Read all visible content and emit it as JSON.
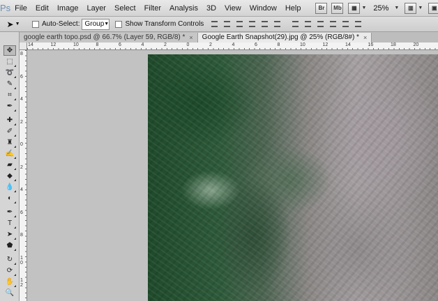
{
  "app": {
    "logo": "Ps"
  },
  "menu": [
    "File",
    "Edit",
    "Image",
    "Layer",
    "Select",
    "Filter",
    "Analysis",
    "3D",
    "View",
    "Window",
    "Help"
  ],
  "menubar_buttons": {
    "bridge": "Br",
    "minibridge": "Mb",
    "zoom": "25%"
  },
  "options": {
    "auto_select_label": "Auto-Select:",
    "auto_select_value": "Group",
    "show_transform_label": "Show Transform Controls"
  },
  "tabs": [
    {
      "label": "google earth topo.psd @ 66.7% (Layer 59, RGB/8) *",
      "close": "×"
    },
    {
      "label": "Google Earth Snapshot(29).jpg @ 25% (RGB/8#) *",
      "close": "×"
    }
  ],
  "ruler": {
    "h_labels": [
      "14",
      "12",
      "10",
      "8",
      "6",
      "4",
      "2",
      "0",
      "2",
      "4",
      "6",
      "8",
      "10",
      "12",
      "14",
      "16",
      "18",
      "20"
    ],
    "v_labels": [
      "8",
      "6",
      "4",
      "2",
      "0",
      "2",
      "4",
      "6",
      "8",
      "10",
      "12"
    ]
  },
  "tools": [
    "move-tool",
    "marquee-tool",
    "lasso-tool",
    "quick-selection-tool",
    "crop-tool",
    "eyedropper-tool",
    "spot-healing-tool",
    "brush-tool",
    "clone-stamp-tool",
    "history-brush-tool",
    "eraser-tool",
    "gradient-tool",
    "blur-tool",
    "dodge-tool",
    "pen-tool",
    "type-tool",
    "path-selection-tool",
    "shape-tool",
    "3d-rotate-tool",
    "3d-orbit-tool",
    "hand-tool",
    "zoom-tool"
  ],
  "colors": {
    "panel": "#d5d5d5",
    "workspace": "#c2c2c2",
    "logo": "#6d8fb1"
  }
}
